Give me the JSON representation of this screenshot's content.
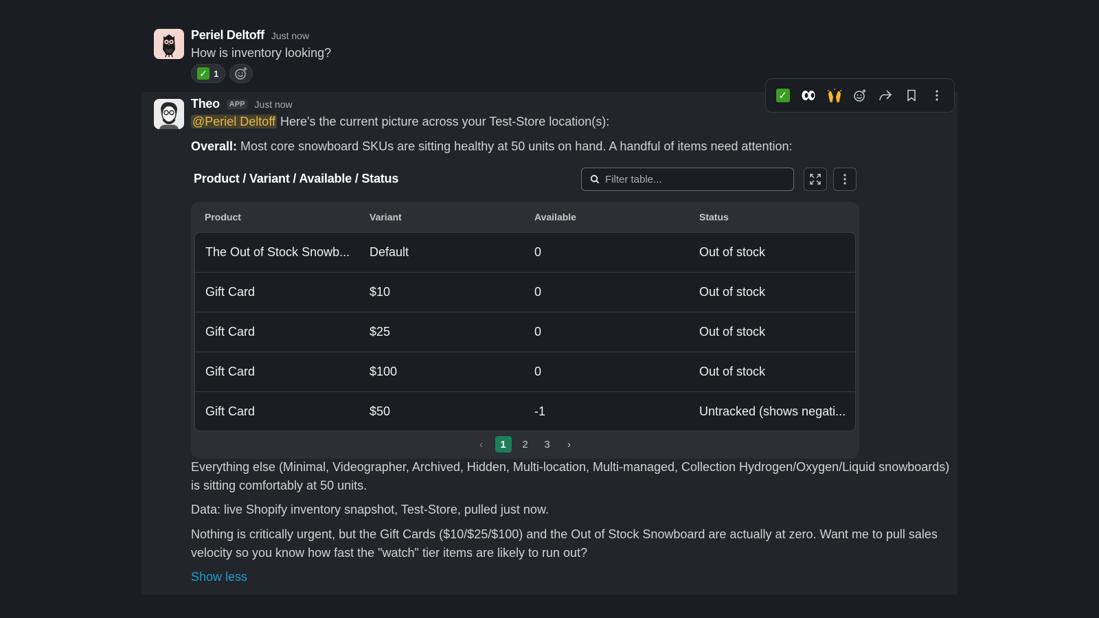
{
  "message1": {
    "author": "Periel Deltoff",
    "time": "Just now",
    "text": "How is inventory looking?",
    "reaction": {
      "emoji": "white-check-mark",
      "count": "1"
    }
  },
  "message2": {
    "author": "Theo",
    "badge": "APP",
    "time": "Just now",
    "mention": "@Periel Deltoff",
    "intro": " Here's the current picture across your Test-Store location(s):",
    "overall_label": "Overall:",
    "overall_text": " Most core snowboard SKUs are sitting healthy at 50 units on hand. A handful of items need attention:",
    "table": {
      "title": "Product / Variant / Available / Status",
      "filter_placeholder": "Filter table...",
      "columns": [
        "Product",
        "Variant",
        "Available",
        "Status"
      ],
      "rows": [
        [
          "The Out of Stock Snowb...",
          "Default",
          "0",
          "Out of stock"
        ],
        [
          "Gift Card",
          "$10",
          "0",
          "Out of stock"
        ],
        [
          "Gift Card",
          "$25",
          "0",
          "Out of stock"
        ],
        [
          "Gift Card",
          "$100",
          "0",
          "Out of stock"
        ],
        [
          "Gift Card",
          "$50",
          "-1",
          "Untracked (shows negati..."
        ]
      ],
      "pages": [
        "1",
        "2",
        "3"
      ],
      "current_page": "1",
      "prev_glyph": "‹",
      "next_glyph": "›"
    },
    "para1": "Everything else (Minimal, Videographer, Archived, Hidden, Multi-location, Multi-managed, Collection Hydrogen/Oxygen/Liquid snowboards) is sitting comfortably at 50 units.",
    "para2": "Data: live Shopify inventory snapshot, Test-Store, pulled just now.",
    "para3": "Nothing is critically urgent, but the Gift Cards ($10/$25/$100) and the Out of Stock Snowboard are actually at zero. Want me to pull sales velocity so you know how fast the \"watch\" tier items are likely to run out?",
    "show_less": "Show less"
  },
  "toolbar": {
    "items": [
      "white-check-mark-icon",
      "eyes-icon",
      "raised-hands-icon",
      "add-reaction-icon",
      "forward-icon",
      "bookmark-icon",
      "more-actions-icon"
    ]
  },
  "colors": {
    "background": "#1a1d21",
    "hover_background": "#222529",
    "mention": "#e8b849",
    "link": "#1d9bd1",
    "page_active": "#1b7e5a"
  }
}
